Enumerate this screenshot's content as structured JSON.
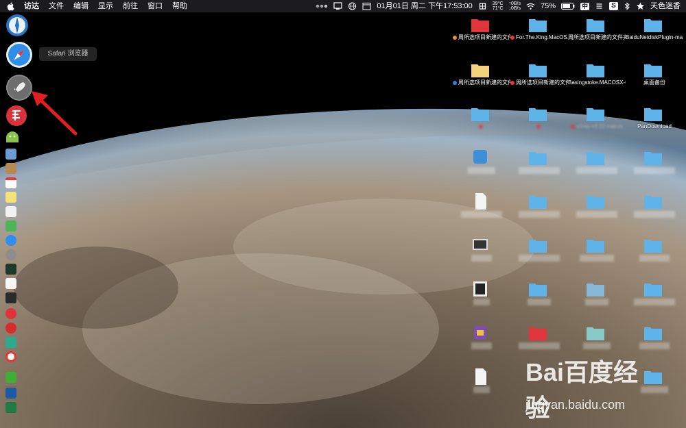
{
  "menubar": {
    "app_name": "访达",
    "menus": [
      "文件",
      "编辑",
      "显示",
      "前往",
      "窗口",
      "帮助"
    ],
    "temp": "39°C",
    "temp2": "71°C",
    "net_up": "0B/s",
    "net_down": "0B/s",
    "datetime": "01月01日 周二 下午17:53:00",
    "battery": "75%",
    "ime": "中",
    "user": "天色迷香"
  },
  "tooltip": "Safari 浏览器",
  "dock": {
    "icons": [
      "compass-icon",
      "safari-icon",
      "launchpad-icon",
      "toolbox-icon",
      "android-icon"
    ]
  },
  "desktop": {
    "files": [
      {
        "label": "周所选项目新建的文件夹 4",
        "tag": "orange"
      },
      {
        "label": "For.The.King.MacOS...VATED",
        "tag": "red"
      },
      {
        "label": "周所选项目新建的文件夹 14",
        "tag": ""
      },
      {
        "label": "BaiduNetdiskPlugin-ma...-master",
        "tag": ""
      },
      {
        "label": "周所选项目新建的文件夹 2",
        "tag": "blue"
      },
      {
        "label": "周所选项目新建的文件夹 10",
        "tag": "red"
      },
      {
        "label": "Basingstoke.MACOSX-GOG",
        "tag": ""
      },
      {
        "label": "桌面备份",
        "tag": ""
      },
      {
        "label": "",
        "tag": "red"
      },
      {
        "label": "",
        "tag": "red"
      },
      {
        "label": "v2ray-v3.22-macos",
        "tag": "red"
      },
      {
        "label": "PanDownload",
        "tag": ""
      }
    ]
  },
  "watermark": {
    "brand": "Bai百度经验",
    "url": "jingyan.baidu.com"
  }
}
